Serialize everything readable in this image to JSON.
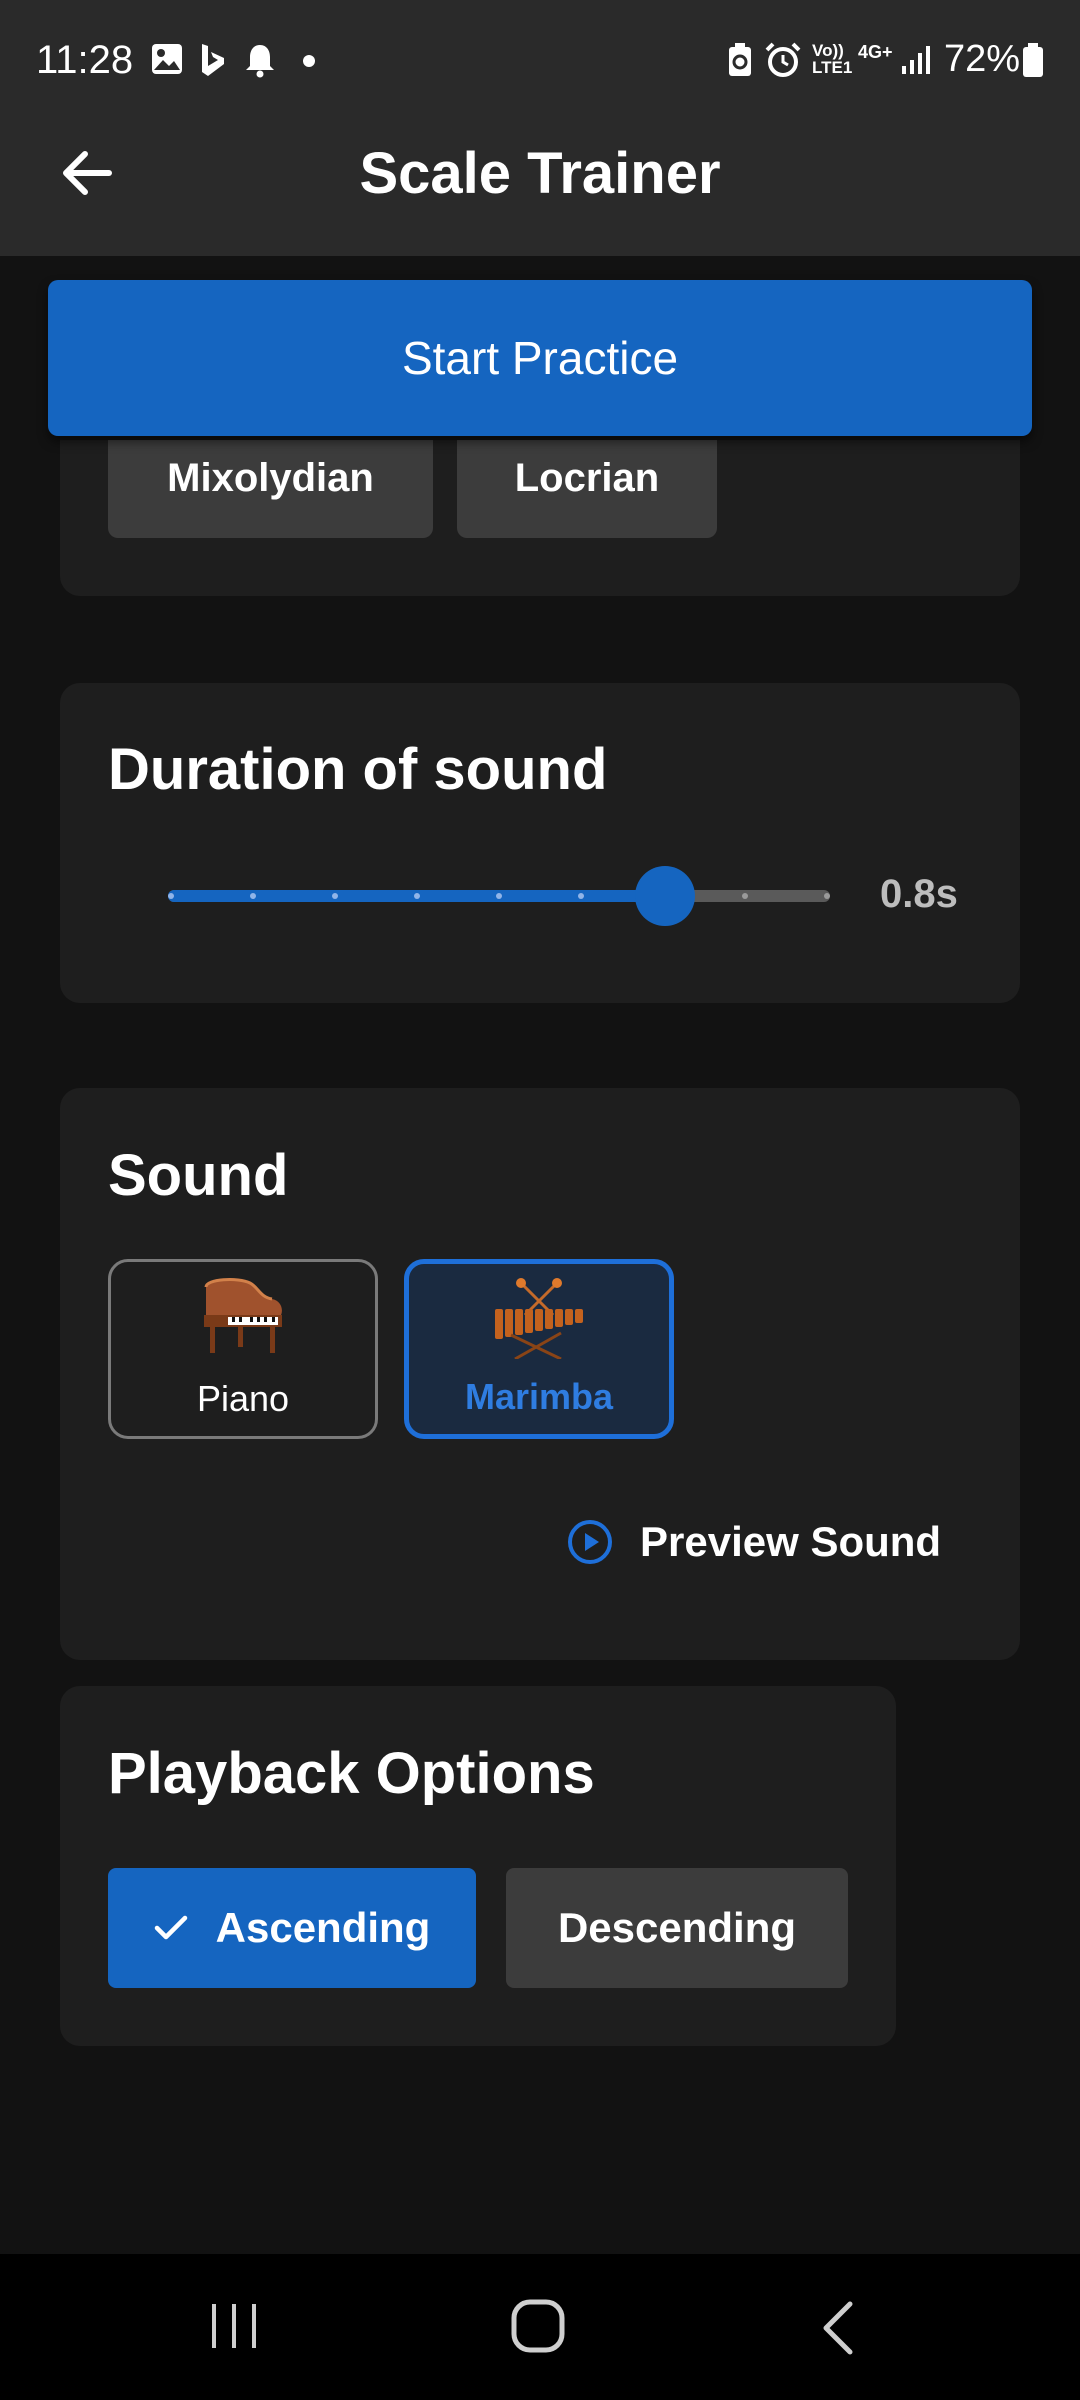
{
  "status_bar": {
    "time": "11:28",
    "battery": "72%",
    "network": "4G+",
    "carrier": "Vo)) LTE1",
    "left_icons": [
      "image-icon",
      "bing-icon",
      "bell-icon",
      "dot-icon"
    ],
    "right_icons": [
      "battery-saver-icon",
      "alarm-icon",
      "signal-icon",
      "battery-icon"
    ]
  },
  "app_bar": {
    "title": "Scale Trainer"
  },
  "start_button": {
    "label": "Start Practice"
  },
  "modes": {
    "items": [
      "Mixolydian",
      "Locrian"
    ]
  },
  "duration": {
    "title": "Duration of sound",
    "value_label": "0.8s",
    "fraction": 0.75
  },
  "sound": {
    "title": "Sound",
    "options": [
      {
        "label": "Piano",
        "icon": "piano-icon",
        "selected": false
      },
      {
        "label": "Marimba",
        "icon": "marimba-icon",
        "selected": true
      }
    ],
    "preview_label": "Preview Sound"
  },
  "playback": {
    "title": "Playback Options",
    "options": [
      {
        "label": "Ascending",
        "selected": true
      },
      {
        "label": "Descending",
        "selected": false
      }
    ]
  },
  "colors": {
    "accent": "#1565c0",
    "card": "#1e1e1e",
    "background": "#121212",
    "chip": "#3c3c3c"
  }
}
